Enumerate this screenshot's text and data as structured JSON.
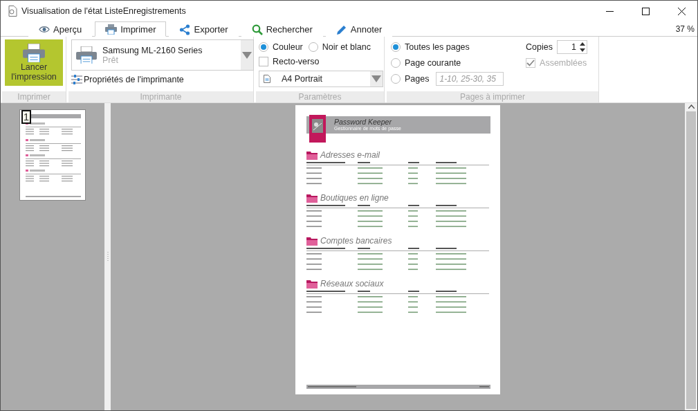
{
  "window": {
    "title": "Visualisation de l'état ListeEnregistrements"
  },
  "tabs": [
    {
      "label": "Aperçu",
      "selected": false
    },
    {
      "label": "Imprimer",
      "selected": true
    },
    {
      "label": "Exporter",
      "selected": false
    },
    {
      "label": "Rechercher",
      "selected": false
    },
    {
      "label": "Annoter",
      "selected": false
    }
  ],
  "zoom": "37 %",
  "print_group": {
    "button": "Lancer l'impression",
    "label": "Imprimer"
  },
  "printer_group": {
    "printer": "Samsung ML-2160 Series",
    "status": "Prêt",
    "properties": "Propriétés de l'imprimante",
    "label": "Imprimante"
  },
  "settings_group": {
    "color_modes": [
      {
        "label": "Couleur",
        "selected": true
      },
      {
        "label": "Noir et blanc",
        "selected": false
      }
    ],
    "duplex": {
      "label": "Recto-verso",
      "checked": false
    },
    "paper": "A4 Portrait",
    "label": "Paramètres"
  },
  "pages_group": {
    "ranges": [
      {
        "label": "Toutes les pages",
        "selected": true
      },
      {
        "label": "Page courante",
        "selected": false
      },
      {
        "label": "Pages",
        "selected": false,
        "placeholder": "1-10, 25-30, 35"
      }
    ],
    "copies_label": "Copies",
    "copies": "1",
    "collate": {
      "label": "Assemblées",
      "checked": true,
      "disabled": true
    },
    "label": "Pages à imprimer"
  },
  "thumbnails": [
    {
      "number": "1",
      "selected": true
    }
  ],
  "document": {
    "title": "Password Keeper",
    "subtitle": "Gestionnaire de mots de passe",
    "sections": [
      {
        "title": "Adresses e-mail"
      },
      {
        "title": "Boutiques en ligne"
      },
      {
        "title": "Comptes bancaires"
      },
      {
        "title": "Réseaux sociaux"
      }
    ]
  }
}
